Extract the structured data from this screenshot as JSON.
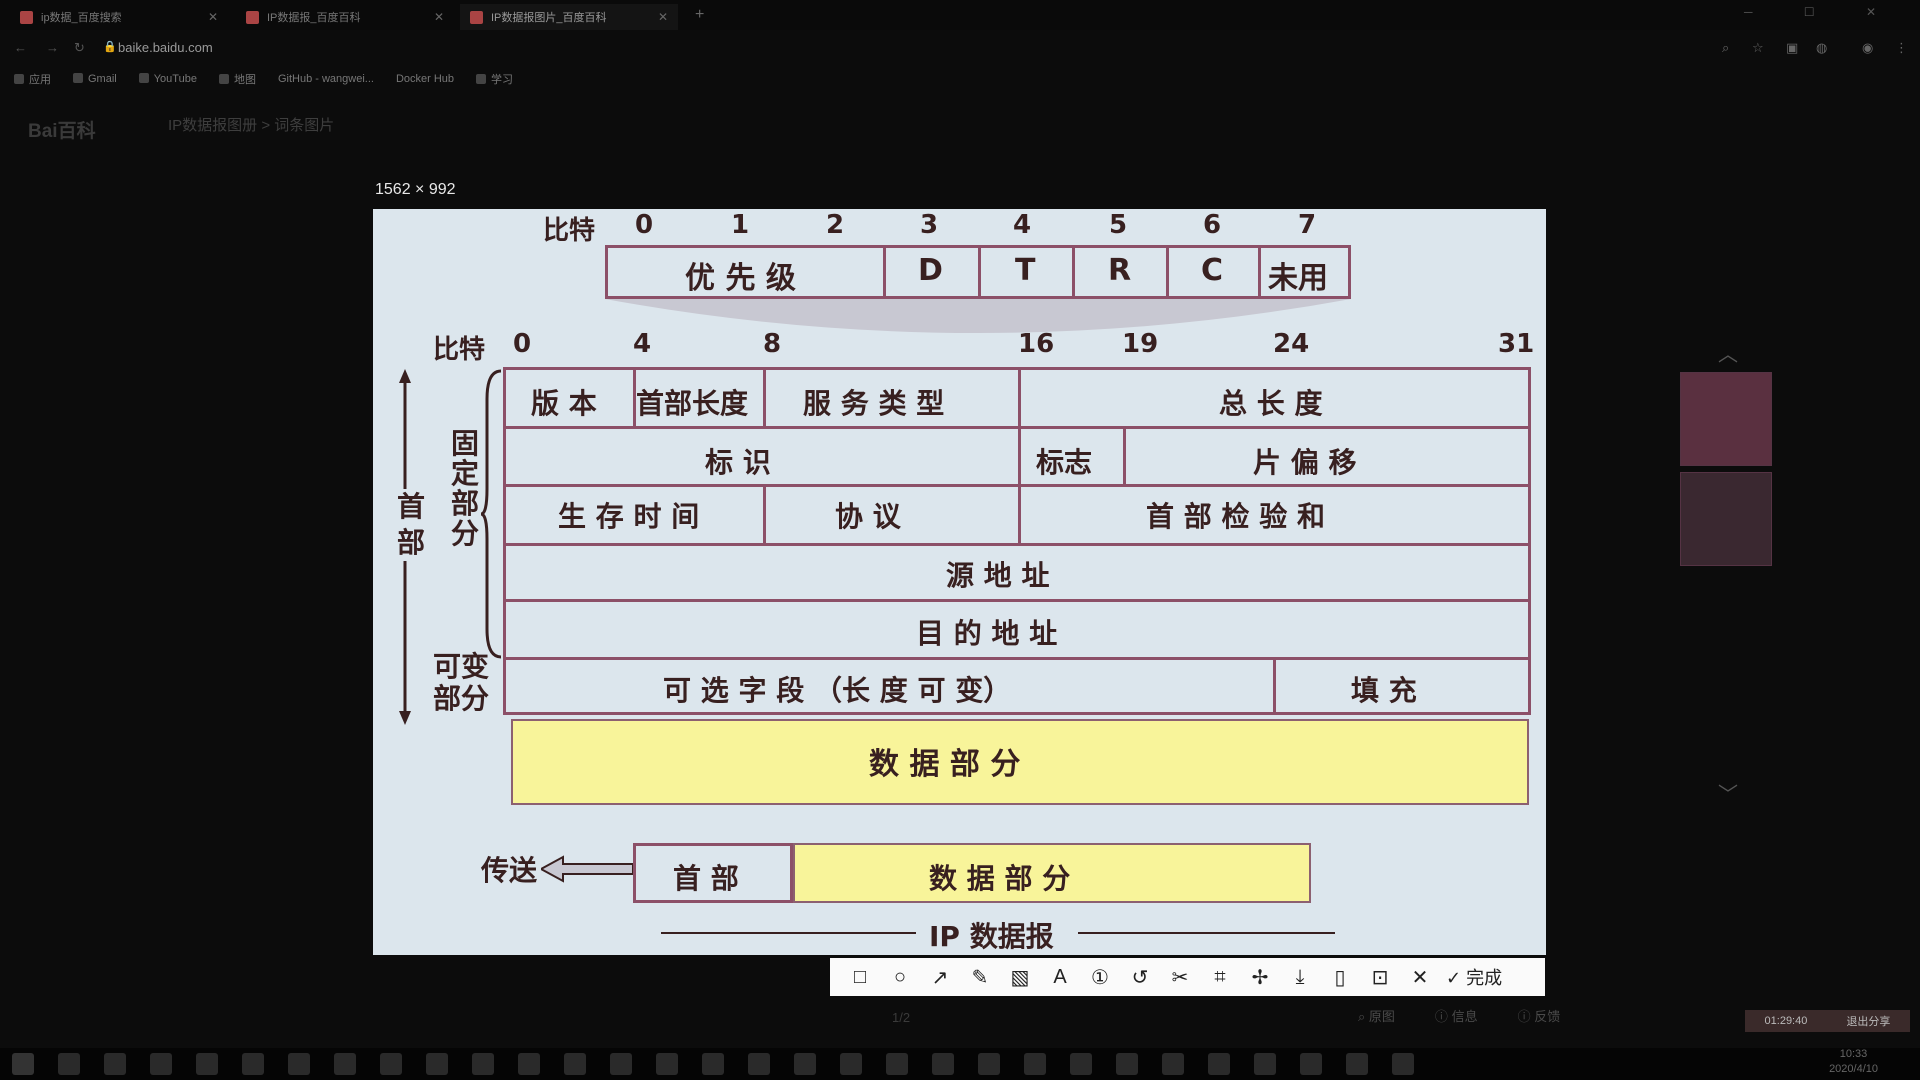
{
  "browser": {
    "tabs": [
      {
        "label": "ip数据_百度搜索"
      },
      {
        "label": "IP数据报_百度百科"
      },
      {
        "label": "IP数据报图片_百度百科"
      }
    ],
    "new_tab": "+",
    "url": "baike.baidu.com",
    "bookmarks": [
      "应用",
      "Gmail",
      "YouTube",
      "地图",
      "GitHub - wangwei...",
      "Docker Hub",
      "学习"
    ]
  },
  "page": {
    "logo": "Bai百科",
    "breadcrumb": "IP数据报图册 > 词条图片",
    "image_size": "1562 × 992",
    "page_indicator": "1/2",
    "bottom_controls": [
      "原图",
      "信息",
      "反馈"
    ]
  },
  "diagram": {
    "tos_bits_label": "比特",
    "tos_bits": [
      "0",
      "1",
      "2",
      "3",
      "4",
      "5",
      "6",
      "7"
    ],
    "tos_fields": [
      "优 先 级",
      "D",
      "T",
      "R",
      "C",
      "未用"
    ],
    "hdr_bits_label": "比特",
    "hdr_bits": [
      "0",
      "4",
      "8",
      "16",
      "19",
      "24",
      "31"
    ],
    "row1": [
      "版 本",
      "首部长度",
      "服 务 类 型",
      "总 长 度"
    ],
    "row2": [
      "标    识",
      "标志",
      "片  偏  移"
    ],
    "row3": [
      "生 存 时 间",
      "协    议",
      "首  部  检  验  和"
    ],
    "row4": "源    地    址",
    "row5": "目    的    地    址",
    "row6": [
      "可   选   字   段  （长   度   可   变）",
      "填     充"
    ],
    "data_part": "数      据      部      分",
    "side_header": "首部",
    "side_fixed": "固定部分",
    "side_var": "可变部分",
    "transmit": "传送",
    "bottom_header": "首    部",
    "bottom_data": "数      据      部      分",
    "caption": "IP 数据报"
  },
  "toolbar": {
    "icons": [
      "rectangle-icon",
      "circle-icon",
      "arrow-icon",
      "pen-icon",
      "mosaic-icon",
      "text-icon",
      "number-icon",
      "undo-icon",
      "scissors-icon",
      "crop-icon",
      "pin-icon",
      "download-icon",
      "phone-icon",
      "bookmark-icon",
      "close-icon"
    ],
    "done": "完成"
  },
  "recording": {
    "time": "01:29:40",
    "stop": "退出分享"
  },
  "clock": {
    "time": "10:33",
    "date": "2020/4/10"
  }
}
